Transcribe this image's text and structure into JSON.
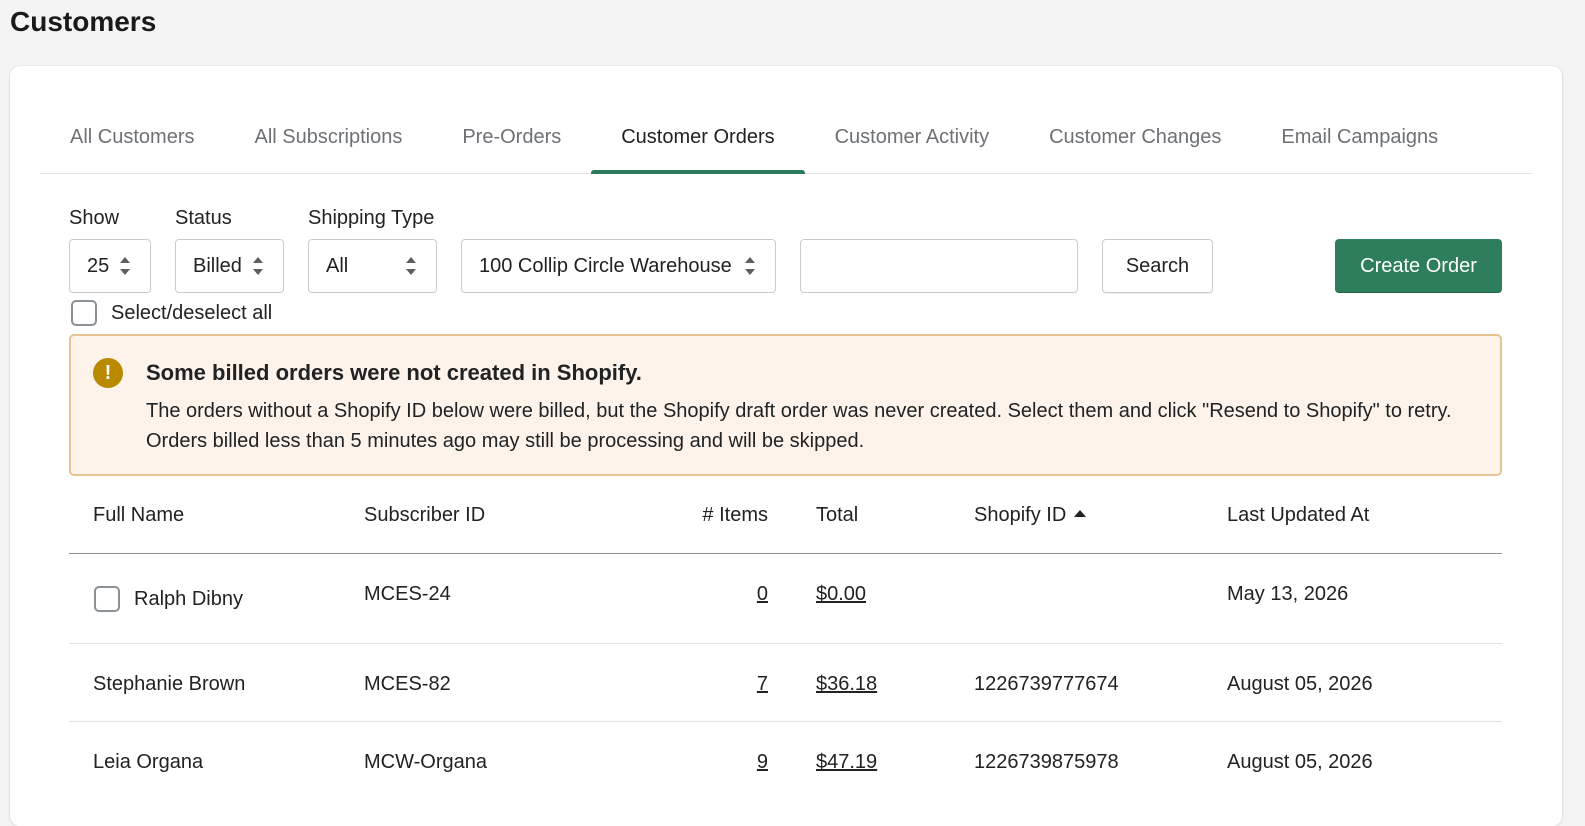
{
  "page": {
    "title": "Customers"
  },
  "tabs": [
    {
      "label": "All Customers"
    },
    {
      "label": "All Subscriptions"
    },
    {
      "label": "Pre-Orders"
    },
    {
      "label": "Customer Orders",
      "active": true
    },
    {
      "label": "Customer Activity"
    },
    {
      "label": "Customer Changes"
    },
    {
      "label": "Email Campaigns"
    }
  ],
  "filters": {
    "show": {
      "label": "Show",
      "value": "25"
    },
    "status": {
      "label": "Status",
      "value": "Billed"
    },
    "shipping_type": {
      "label": "Shipping Type",
      "value": "All"
    },
    "warehouse": {
      "value": "100 Collip Circle Warehouse"
    },
    "search": {
      "value": "",
      "button_label": "Search"
    },
    "create_order_label": "Create Order",
    "select_all_label": "Select/deselect all"
  },
  "banner": {
    "icon": "exclamation-icon",
    "title": "Some billed orders were not created in Shopify.",
    "body": "The orders without a Shopify ID below were billed, but the Shopify draft order was never created. Select them and click \"Resend to Shopify\" to retry. Orders billed less than 5 minutes ago may still be processing and will be skipped."
  },
  "table": {
    "columns": [
      "Full Name",
      "Subscriber ID",
      "# Items",
      "Total",
      "Shopify ID",
      "Last Updated At"
    ],
    "sort": {
      "column": "Shopify ID",
      "direction": "ascending"
    },
    "rows": [
      {
        "full_name": "Ralph Dibny",
        "subscriber_id": "MCES-24",
        "items": "0",
        "total": "$0.00",
        "shopify_id": "",
        "last_updated": "May 13, 2026",
        "selectable": true
      },
      {
        "full_name": "Stephanie Brown",
        "subscriber_id": "MCES-82",
        "items": "7",
        "total": "$36.18",
        "shopify_id": "1226739777674",
        "last_updated": "August 05, 2026",
        "selectable": false
      },
      {
        "full_name": "Leia Organa",
        "subscriber_id": "MCW-Organa",
        "items": "9",
        "total": "$47.19",
        "shopify_id": "1226739875978",
        "last_updated": "August 05, 2026",
        "selectable": false
      }
    ]
  },
  "colors": {
    "primary": "#2e7d5b",
    "banner_bg": "#fdf3ea",
    "banner_border": "#e6c393",
    "warning_icon": "#b98900"
  }
}
